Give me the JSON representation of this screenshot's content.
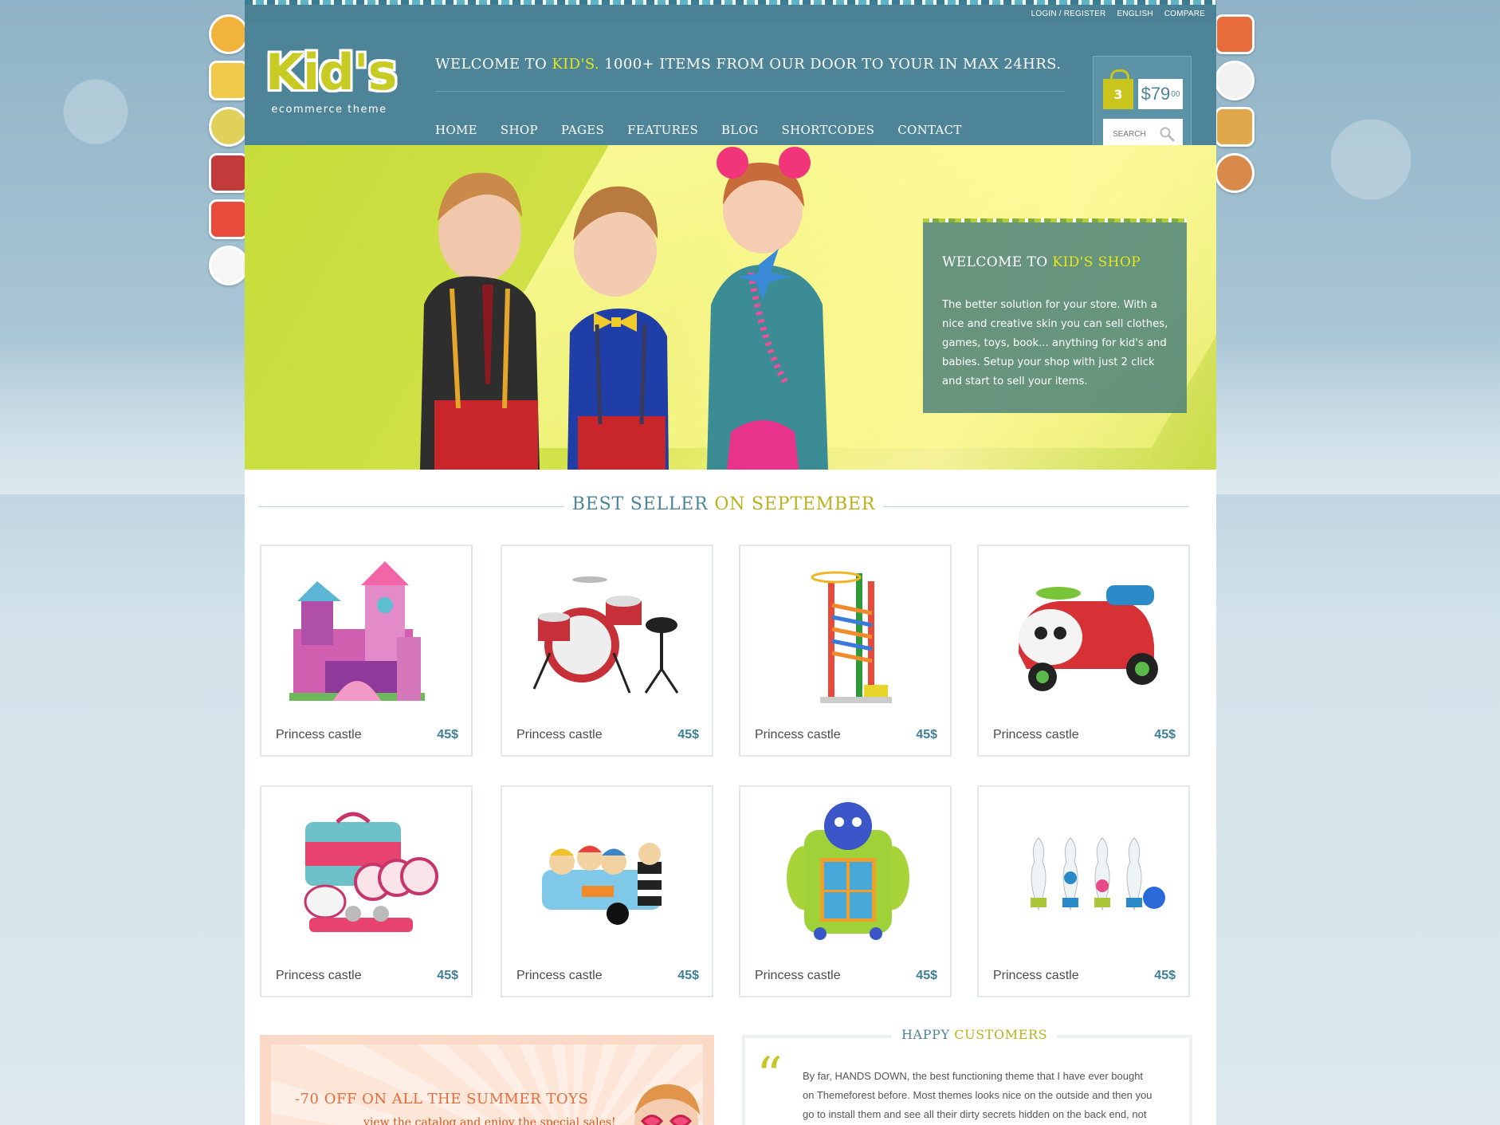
{
  "colors": {
    "header_bg": "#4d8497",
    "accent_yellow": "#e6e61a",
    "accent_olive": "#b9b21b",
    "price_blue": "#3d7f98",
    "hero_card": "#4e827a"
  },
  "utility": {
    "login": "LOGIN / REGISTER",
    "language": "ENGLISH",
    "compare": "COMPARE"
  },
  "logo": {
    "word": "Kid's",
    "subtitle": "ecommerce theme"
  },
  "header": {
    "welcome_prefix": "WELCOME TO ",
    "welcome_brand": "KID'S.",
    "welcome_suffix": " 1000+ ITEMS FROM OUR DOOR TO YOUR IN MAX 24HRS."
  },
  "nav": {
    "items": [
      "HOME",
      "SHOP",
      "PAGES",
      "FEATURES",
      "BLOG",
      "SHORTCODES",
      "CONTACT"
    ]
  },
  "cart": {
    "count": "3",
    "price_main": "$79",
    "price_cents": "00",
    "search_placeholder": "SEARCH",
    "icons": {
      "search": "search-icon",
      "bag": "shopping-bag-icon"
    }
  },
  "hero": {
    "card_title_prefix": "WELCOME TO ",
    "card_title_brand": "KID'S SHOP",
    "card_text": "The better solution for your store. With a nice and creative skin you can sell clothes, games, toys, book... anything for kid's and babies. Setup your shop with just 2 click and start to sell your items."
  },
  "bestseller": {
    "title_prefix": "BEST SELLER ",
    "title_highlight": "ON SEPTEMBER"
  },
  "products": [
    {
      "name": "Princess castle",
      "price": "45$",
      "icon": "castle-toy-icon"
    },
    {
      "name": "Princess castle",
      "price": "45$",
      "icon": "drum-kit-icon"
    },
    {
      "name": "Princess castle",
      "price": "45$",
      "icon": "marble-run-icon"
    },
    {
      "name": "Princess castle",
      "price": "45$",
      "icon": "ride-on-car-icon"
    },
    {
      "name": "Princess castle",
      "price": "45$",
      "icon": "tea-set-icon"
    },
    {
      "name": "Princess castle",
      "price": "45$",
      "icon": "pirate-boat-icon"
    },
    {
      "name": "Princess castle",
      "price": "45$",
      "icon": "puzzle-toy-icon"
    },
    {
      "name": "Princess castle",
      "price": "45$",
      "icon": "bowling-set-icon"
    }
  ],
  "promo": {
    "title": "-70 OFF ON ALL THE SUMMER TOYS",
    "subtitle": "view the catalog and enjoy the special sales!"
  },
  "testimonial": {
    "title_prefix": "HAPPY ",
    "title_highlight": "CUSTOMERS",
    "quote_mark": "“",
    "text": "By far, HANDS DOWN, the best functioning theme that I have ever bought on Themeforest before. Most themes looks nice on the outside and then you go to install them and see all their dirty secrets hidden on the back end, not this theme."
  }
}
